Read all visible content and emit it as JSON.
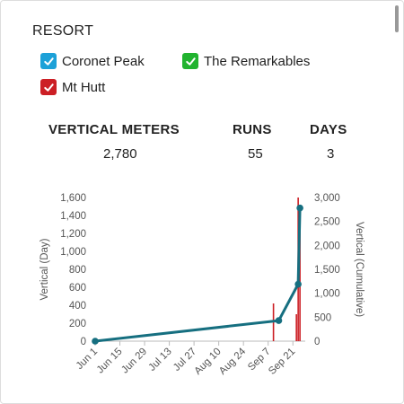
{
  "resort": {
    "title": "RESORT",
    "filters": [
      {
        "label": "Coronet Peak",
        "checked": true,
        "color": "#1da1d8"
      },
      {
        "label": "The Remarkables",
        "checked": true,
        "color": "#21b32f"
      },
      {
        "label": "Mt Hutt",
        "checked": true,
        "color": "#cc1f25"
      }
    ]
  },
  "stats": {
    "vertical_label": "VERTICAL METERS",
    "vertical_value": "2,780",
    "runs_label": "RUNS",
    "runs_value": "55",
    "days_label": "DAYS",
    "days_value": "3"
  },
  "chart_data": {
    "type": "line",
    "x_tick_labels": [
      "Jun 1",
      "Jun 15",
      "Jun 29",
      "Jul 13",
      "Jul 27",
      "Aug 10",
      "Aug 24",
      "Sep 7",
      "Sep 21"
    ],
    "xlim": [
      "Jun 1",
      "Sep 28"
    ],
    "ylabel": "Vertical (Day)",
    "ylim": [
      0,
      1600
    ],
    "y_ticks": [
      0,
      200,
      400,
      600,
      800,
      1000,
      1200,
      1400,
      1600
    ],
    "y2label": "Vertical (Cumulative)",
    "y2lim": [
      0,
      3000
    ],
    "y2_ticks": [
      0,
      500,
      1000,
      1500,
      2000,
      2500,
      3000
    ],
    "series": [
      {
        "type": "bar",
        "axis": "left",
        "color": "#cc1f25",
        "points": [
          {
            "x": "Sep 10",
            "y": 420
          },
          {
            "x": "Sep 23",
            "y": 300
          },
          {
            "x": "Sep 24",
            "y": 1600
          },
          {
            "x": "Sep 25",
            "y": 1500
          }
        ]
      },
      {
        "type": "line",
        "axis": "right",
        "color": "#166f80",
        "points": [
          {
            "x": "Jun 1",
            "y": 0
          },
          {
            "x": "Sep 13",
            "y": 430
          },
          {
            "x": "Sep 24",
            "y": 1190
          },
          {
            "x": "Sep 25",
            "y": 2780
          }
        ]
      }
    ]
  }
}
